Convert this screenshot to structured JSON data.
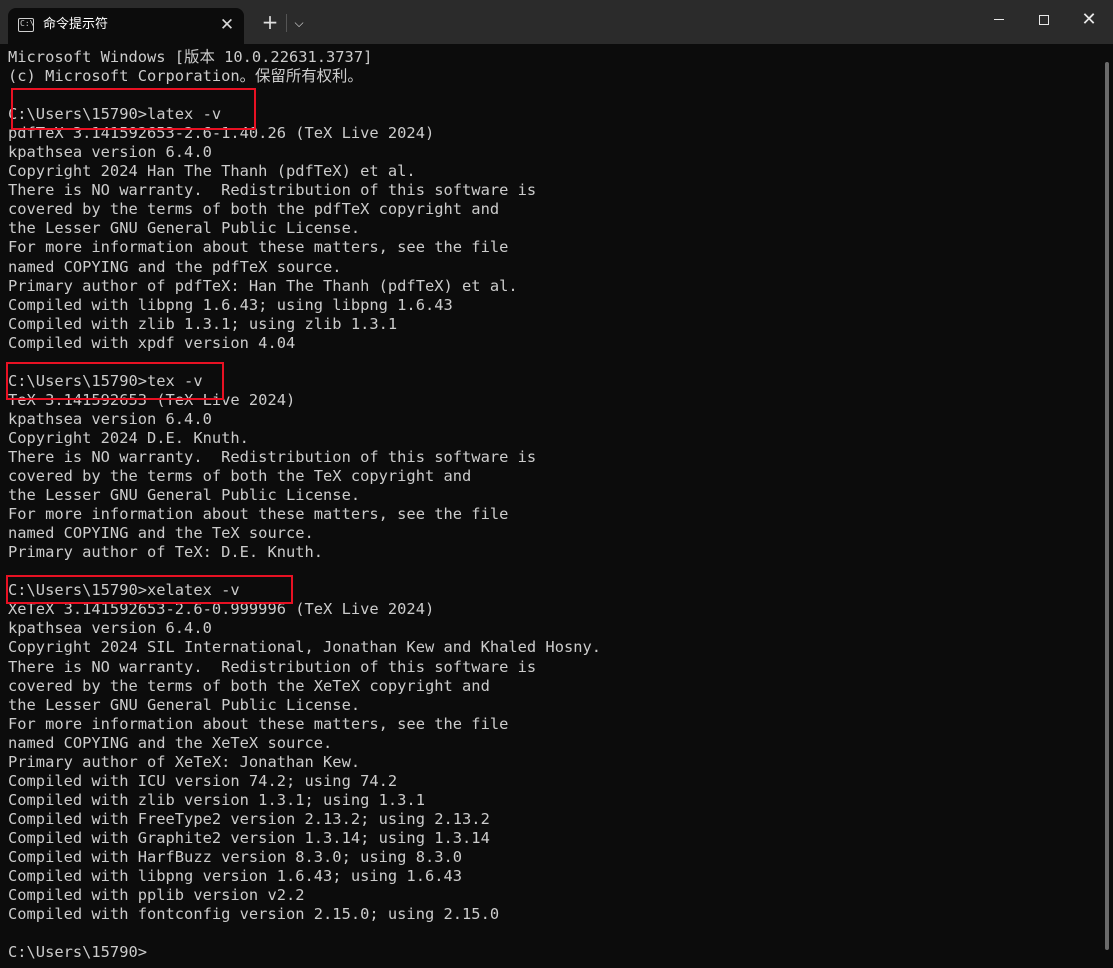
{
  "window": {
    "tab_title": "命令提示符",
    "tab_icon_glyph": "C:\\",
    "icons": {
      "tab": "terminal-icon",
      "close_tab": "close-icon",
      "new_tab": "plus-icon",
      "dropdown": "chevron-down-icon",
      "minimize": "minimize-icon",
      "maximize": "maximize-icon",
      "close_window": "close-icon"
    },
    "close_glyph": "✕",
    "plus_glyph": "+",
    "chevron_glyph": "⌵"
  },
  "colors": {
    "background": "#0c0c0c",
    "titlebar": "#2b2b2b",
    "text": "#cccccc",
    "highlight_box": "#e81123"
  },
  "terminal": {
    "lines": [
      "Microsoft Windows [版本 10.0.22631.3737]",
      "(c) Microsoft Corporation。保留所有权利。",
      "",
      "C:\\Users\\15790>latex -v",
      "pdfTeX 3.141592653-2.6-1.40.26 (TeX Live 2024)",
      "kpathsea version 6.4.0",
      "Copyright 2024 Han The Thanh (pdfTeX) et al.",
      "There is NO warranty.  Redistribution of this software is",
      "covered by the terms of both the pdfTeX copyright and",
      "the Lesser GNU General Public License.",
      "For more information about these matters, see the file",
      "named COPYING and the pdfTeX source.",
      "Primary author of pdfTeX: Han The Thanh (pdfTeX) et al.",
      "Compiled with libpng 1.6.43; using libpng 1.6.43",
      "Compiled with zlib 1.3.1; using zlib 1.3.1",
      "Compiled with xpdf version 4.04",
      "",
      "C:\\Users\\15790>tex -v",
      "TeX 3.141592653 (TeX Live 2024)",
      "kpathsea version 6.4.0",
      "Copyright 2024 D.E. Knuth.",
      "There is NO warranty.  Redistribution of this software is",
      "covered by the terms of both the TeX copyright and",
      "the Lesser GNU General Public License.",
      "For more information about these matters, see the file",
      "named COPYING and the TeX source.",
      "Primary author of TeX: D.E. Knuth.",
      "",
      "C:\\Users\\15790>xelatex -v",
      "XeTeX 3.141592653-2.6-0.999996 (TeX Live 2024)",
      "kpathsea version 6.4.0",
      "Copyright 2024 SIL International, Jonathan Kew and Khaled Hosny.",
      "There is NO warranty.  Redistribution of this software is",
      "covered by the terms of both the XeTeX copyright and",
      "the Lesser GNU General Public License.",
      "For more information about these matters, see the file",
      "named COPYING and the XeTeX source.",
      "Primary author of XeTeX: Jonathan Kew.",
      "Compiled with ICU version 74.2; using 74.2",
      "Compiled with zlib version 1.3.1; using 1.3.1",
      "Compiled with FreeType2 version 2.13.2; using 2.13.2",
      "Compiled with Graphite2 version 1.3.14; using 1.3.14",
      "Compiled with HarfBuzz version 8.3.0; using 8.3.0",
      "Compiled with libpng version 1.6.43; using 1.6.43",
      "Compiled with pplib version v2.2",
      "Compiled with fontconfig version 2.15.0; using 2.15.0",
      "",
      "C:\\Users\\15790>"
    ]
  }
}
